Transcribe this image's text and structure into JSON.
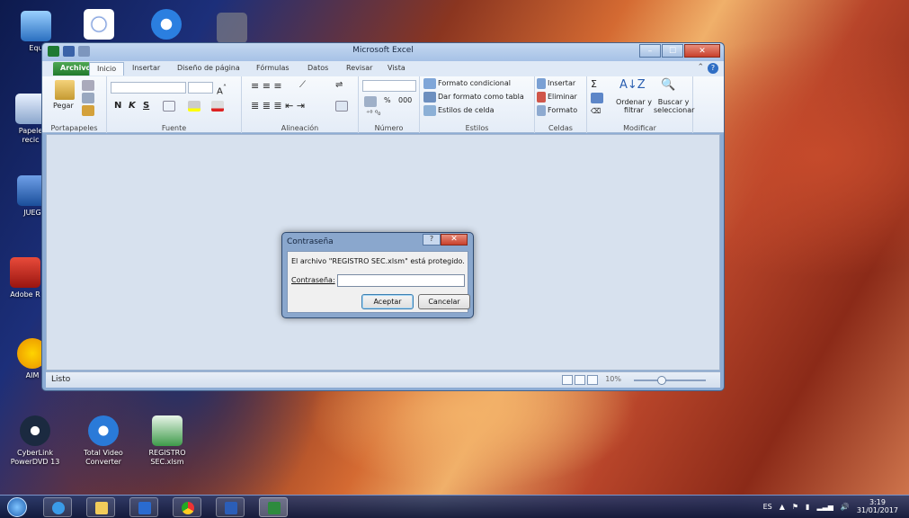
{
  "desktop": {
    "icons": [
      {
        "label": "Equ",
        "icon": "computer-icon"
      },
      {
        "label": "Papele recic",
        "icon": "recycle-bin-icon"
      },
      {
        "label": "JUEG",
        "icon": "game-icon"
      },
      {
        "label": "Adobe R",
        "icon": "adobe-reader-icon"
      },
      {
        "label": "AIM",
        "icon": "aim-icon"
      },
      {
        "label": "CyberLink PowerDVD 13",
        "icon": "powerdvd-icon"
      },
      {
        "label": "Total Video Converter",
        "icon": "converter-icon"
      },
      {
        "label": "REGISTRO SEC.xlsm",
        "icon": "excel-file-icon"
      }
    ]
  },
  "excel": {
    "title": "Microsoft Excel",
    "tabs": [
      "Archivo",
      "Inicio",
      "Insertar",
      "Diseño de página",
      "Fórmulas",
      "Datos",
      "Revisar",
      "Vista"
    ],
    "active_tab": "Inicio",
    "ribbon": {
      "groups": {
        "clipboard": "Portapapeles",
        "font": "Fuente",
        "alignment": "Alineación",
        "number": "Número",
        "styles": "Estilos",
        "cells": "Celdas",
        "edit": "Modificar"
      },
      "paste": "Pegar",
      "bold": "N",
      "italic": "K",
      "underline": "S",
      "percent": "%",
      "thousands": "000",
      "cond_format": "Formato condicional",
      "table_format": "Dar formato como tabla",
      "cell_styles": "Estilos de celda",
      "insert": "Insertar",
      "delete": "Eliminar",
      "format": "Formato",
      "sort": "Ordenar y filtrar",
      "find": "Buscar y seleccionar"
    },
    "status": {
      "text": "Listo",
      "zoom": "10%"
    }
  },
  "dialog": {
    "title": "Contraseña",
    "message": "El archivo \"REGISTRO SEC.xlsm\" está protegido.",
    "password_label": "Contraseña:",
    "password_value": "",
    "ok": "Aceptar",
    "cancel": "Cancelar"
  },
  "taskbar": {
    "lang": "ES",
    "time": "3:19",
    "date": "31/01/2017"
  }
}
